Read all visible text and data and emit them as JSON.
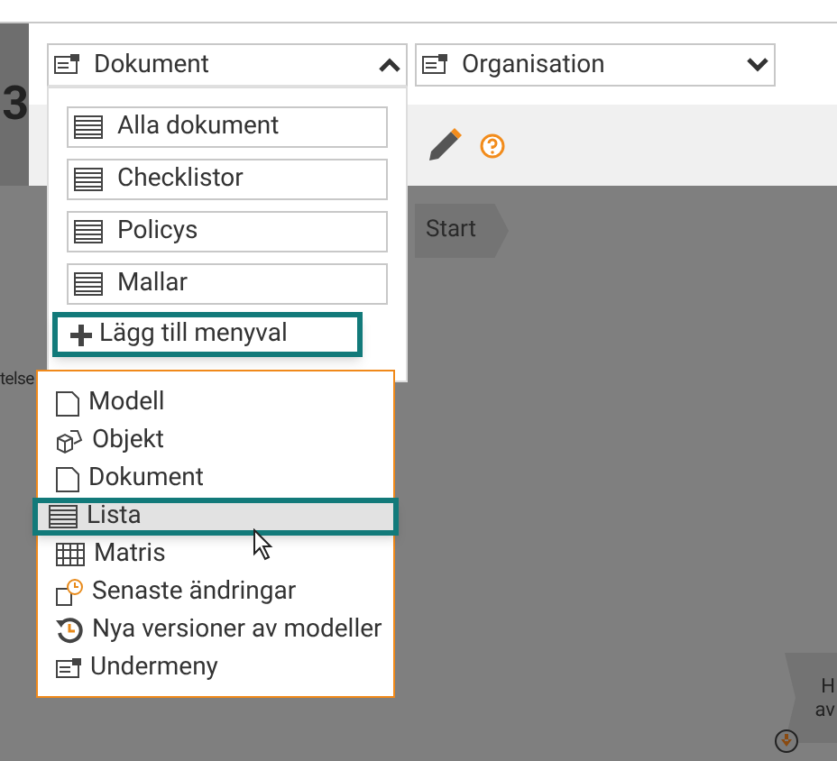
{
  "page_number": "3",
  "selects": [
    {
      "label": "Dokument",
      "expanded": true
    },
    {
      "label": "Organisation",
      "expanded": false
    }
  ],
  "menu_items": [
    {
      "label": "Alla dokument"
    },
    {
      "label": "Checklistor"
    },
    {
      "label": "Policys"
    },
    {
      "label": "Mallar"
    }
  ],
  "add_button": {
    "label": "Lägg till menyval",
    "focused": true
  },
  "submenu": [
    {
      "label": "Modell",
      "kind": "model",
      "selected": false
    },
    {
      "label": "Objekt",
      "kind": "object",
      "selected": false
    },
    {
      "label": "Dokument",
      "kind": "document",
      "selected": false
    },
    {
      "label": "Lista",
      "kind": "list",
      "selected": true
    },
    {
      "label": "Matris",
      "kind": "matrix",
      "selected": false
    },
    {
      "label": "Senaste ändringar",
      "kind": "recent",
      "selected": false
    },
    {
      "label": "Nya versioner av modeller",
      "kind": "versions",
      "selected": false
    },
    {
      "label": "Undermeny",
      "kind": "submenu",
      "selected": false
    }
  ],
  "canvas": {
    "side_text": "telse",
    "start_node": "Start",
    "node_lines": [
      "H",
      "av"
    ]
  }
}
